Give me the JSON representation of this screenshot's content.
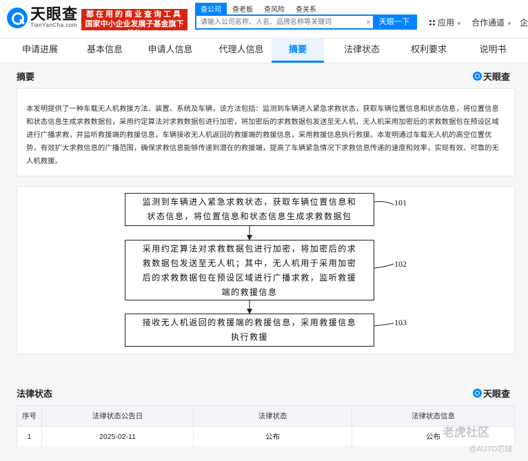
{
  "brand": {
    "name_cn": "天眼查",
    "name_en": "TianYanCha.com",
    "promo_line1": "都在用的商业查询工具",
    "promo_line2": "国家中小企业发展子基金旗下机构"
  },
  "search": {
    "tabs": [
      "查公司",
      "查老板",
      "查风险",
      "查关系"
    ],
    "placeholder": "请输入公司名称、人名、品牌名称等关键词",
    "button": "天眼一下"
  },
  "header_links": {
    "apps": "应用",
    "cooperation": "合作通道",
    "cut": "企"
  },
  "nav": {
    "tabs": [
      "申请进展",
      "基本信息",
      "申请人信息",
      "代理人信息",
      "摘要",
      "法律状态",
      "权利要求",
      "说明书"
    ],
    "active_index": 4
  },
  "abstract": {
    "title": "摘要",
    "brand_label": "天眼查",
    "text": "本发明提供了一种车载无人机救援方法、装置、系统及车辆，该方法包括：监测到车辆进入紧急求救状态，获取车辆位置信息和状态信息，将位置信息和状态信息生成求救数据包，采用约定算法对求救数据包进行加密，将加密后的求救数据包发送至无人机，无人机采用加密后的求救数据包在预设区域进行广播求救，并监听救援端的救援信息，车辆接收无人机返回的救援端的救援信息，采用救援信息执行救援。本发明通过车载无人机的高空位置优势，有效扩大求救信息的广播范围，确保求救信息能够传递到潜在的救援端，提高了车辆紧急情况下求救信息传递的速度和效率，实现有效、可靠的无人机救援。"
  },
  "flowchart": {
    "steps": [
      {
        "ref": "101",
        "lines": [
          "监测到车辆进入紧急求救状态，获取车辆位置信息和",
          "状态信息，将位置信息和状态信息生成求救数据包"
        ]
      },
      {
        "ref": "102",
        "lines": [
          "采用约定算法对求救数据包进行加密，将加密后的求",
          "救数据包发送至无人机；其中，无人机用于采用加密",
          "后的求救数据包在预设区域进行广播求救，监听救援",
          "端的救援信息"
        ]
      },
      {
        "ref": "103",
        "lines": [
          "接收无人机返回的救援端的救援信息，采用救援信息",
          "执行救援"
        ]
      }
    ]
  },
  "legal": {
    "title": "法律状态",
    "brand_label": "天眼查",
    "headers": [
      "序号",
      "法律状态公告日",
      "法律状态",
      "法律状态信息"
    ],
    "rows": [
      [
        "1",
        "2025-02-11",
        "公布",
        "公布"
      ]
    ]
  },
  "watermark": {
    "line1": "老虎社区",
    "line2": "@AUTO芯球"
  },
  "colors": {
    "accent": "#0084ff",
    "promo_red": "#d9230f",
    "page_bg": "#f5f6f8"
  }
}
